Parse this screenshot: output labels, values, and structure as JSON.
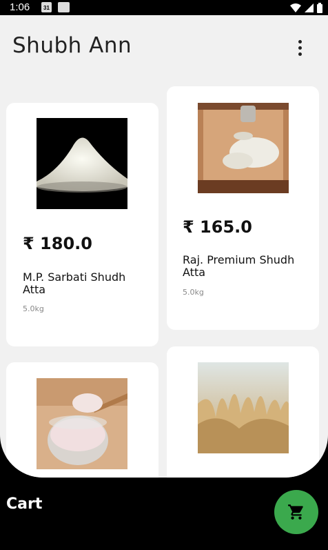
{
  "status_bar": {
    "time": "1:06",
    "calendar_day": "31"
  },
  "app": {
    "title": "Shubh Ann"
  },
  "products": [
    {
      "price": "₹ 180.0",
      "name": "M.P. Sarbati Shudh Atta",
      "weight": "5.0kg",
      "image": "flour-pile-image"
    },
    {
      "price": "₹ 165.0",
      "name": "Raj. Premium Shudh Atta",
      "weight": "5.0kg",
      "image": "flour-on-board-image"
    },
    {
      "image": "flour-in-bowl-image"
    },
    {
      "image": "wheat-field-image"
    }
  ],
  "bottom_bar": {
    "cart_label": "Cart",
    "cart_icon": "shopping-cart-icon"
  }
}
